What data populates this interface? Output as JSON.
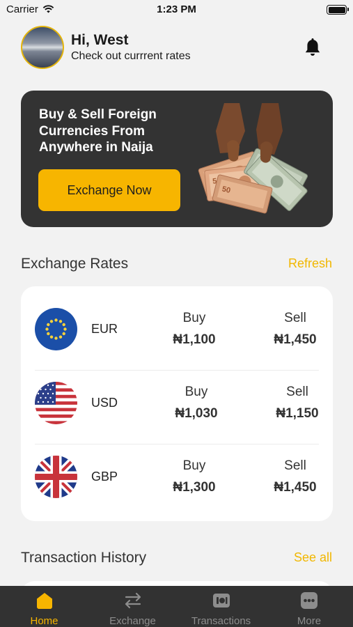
{
  "status_bar": {
    "carrier": "Carrier",
    "time": "1:23 PM"
  },
  "header": {
    "greeting": "Hi, West",
    "subtitle": "Check out currrent rates"
  },
  "banner": {
    "title": "Buy & Sell Foreign Currencies From Anywhere in Naija",
    "button_label": "Exchange Now"
  },
  "rates_section": {
    "title": "Exchange Rates",
    "refresh_label": "Refresh",
    "rows": [
      {
        "code": "EUR",
        "buy_label": "Buy",
        "buy": "₦1,100",
        "sell_label": "Sell",
        "sell": "₦1,450",
        "flag": "eu-flag-icon"
      },
      {
        "code": "USD",
        "buy_label": "Buy",
        "buy": "₦1,030",
        "sell_label": "Sell",
        "sell": "₦1,150",
        "flag": "us-flag-icon"
      },
      {
        "code": "GBP",
        "buy_label": "Buy",
        "buy": "₦1,300",
        "sell_label": "Sell",
        "sell": "₦1,450",
        "flag": "uk-flag-icon"
      }
    ]
  },
  "history_section": {
    "title": "Transaction History",
    "see_all_label": "See all"
  },
  "tab_bar": {
    "items": [
      {
        "label": "Home",
        "icon": "home-icon",
        "active": true
      },
      {
        "label": "Exchange",
        "icon": "exchange-icon",
        "active": false
      },
      {
        "label": "Transactions",
        "icon": "transactions-icon",
        "active": false
      },
      {
        "label": "More",
        "icon": "more-icon",
        "active": false
      }
    ]
  },
  "colors": {
    "accent": "#f7b500",
    "banner_bg": "#333333",
    "tab_bar_bg": "#323232",
    "page_bg": "#f2f2f2"
  }
}
